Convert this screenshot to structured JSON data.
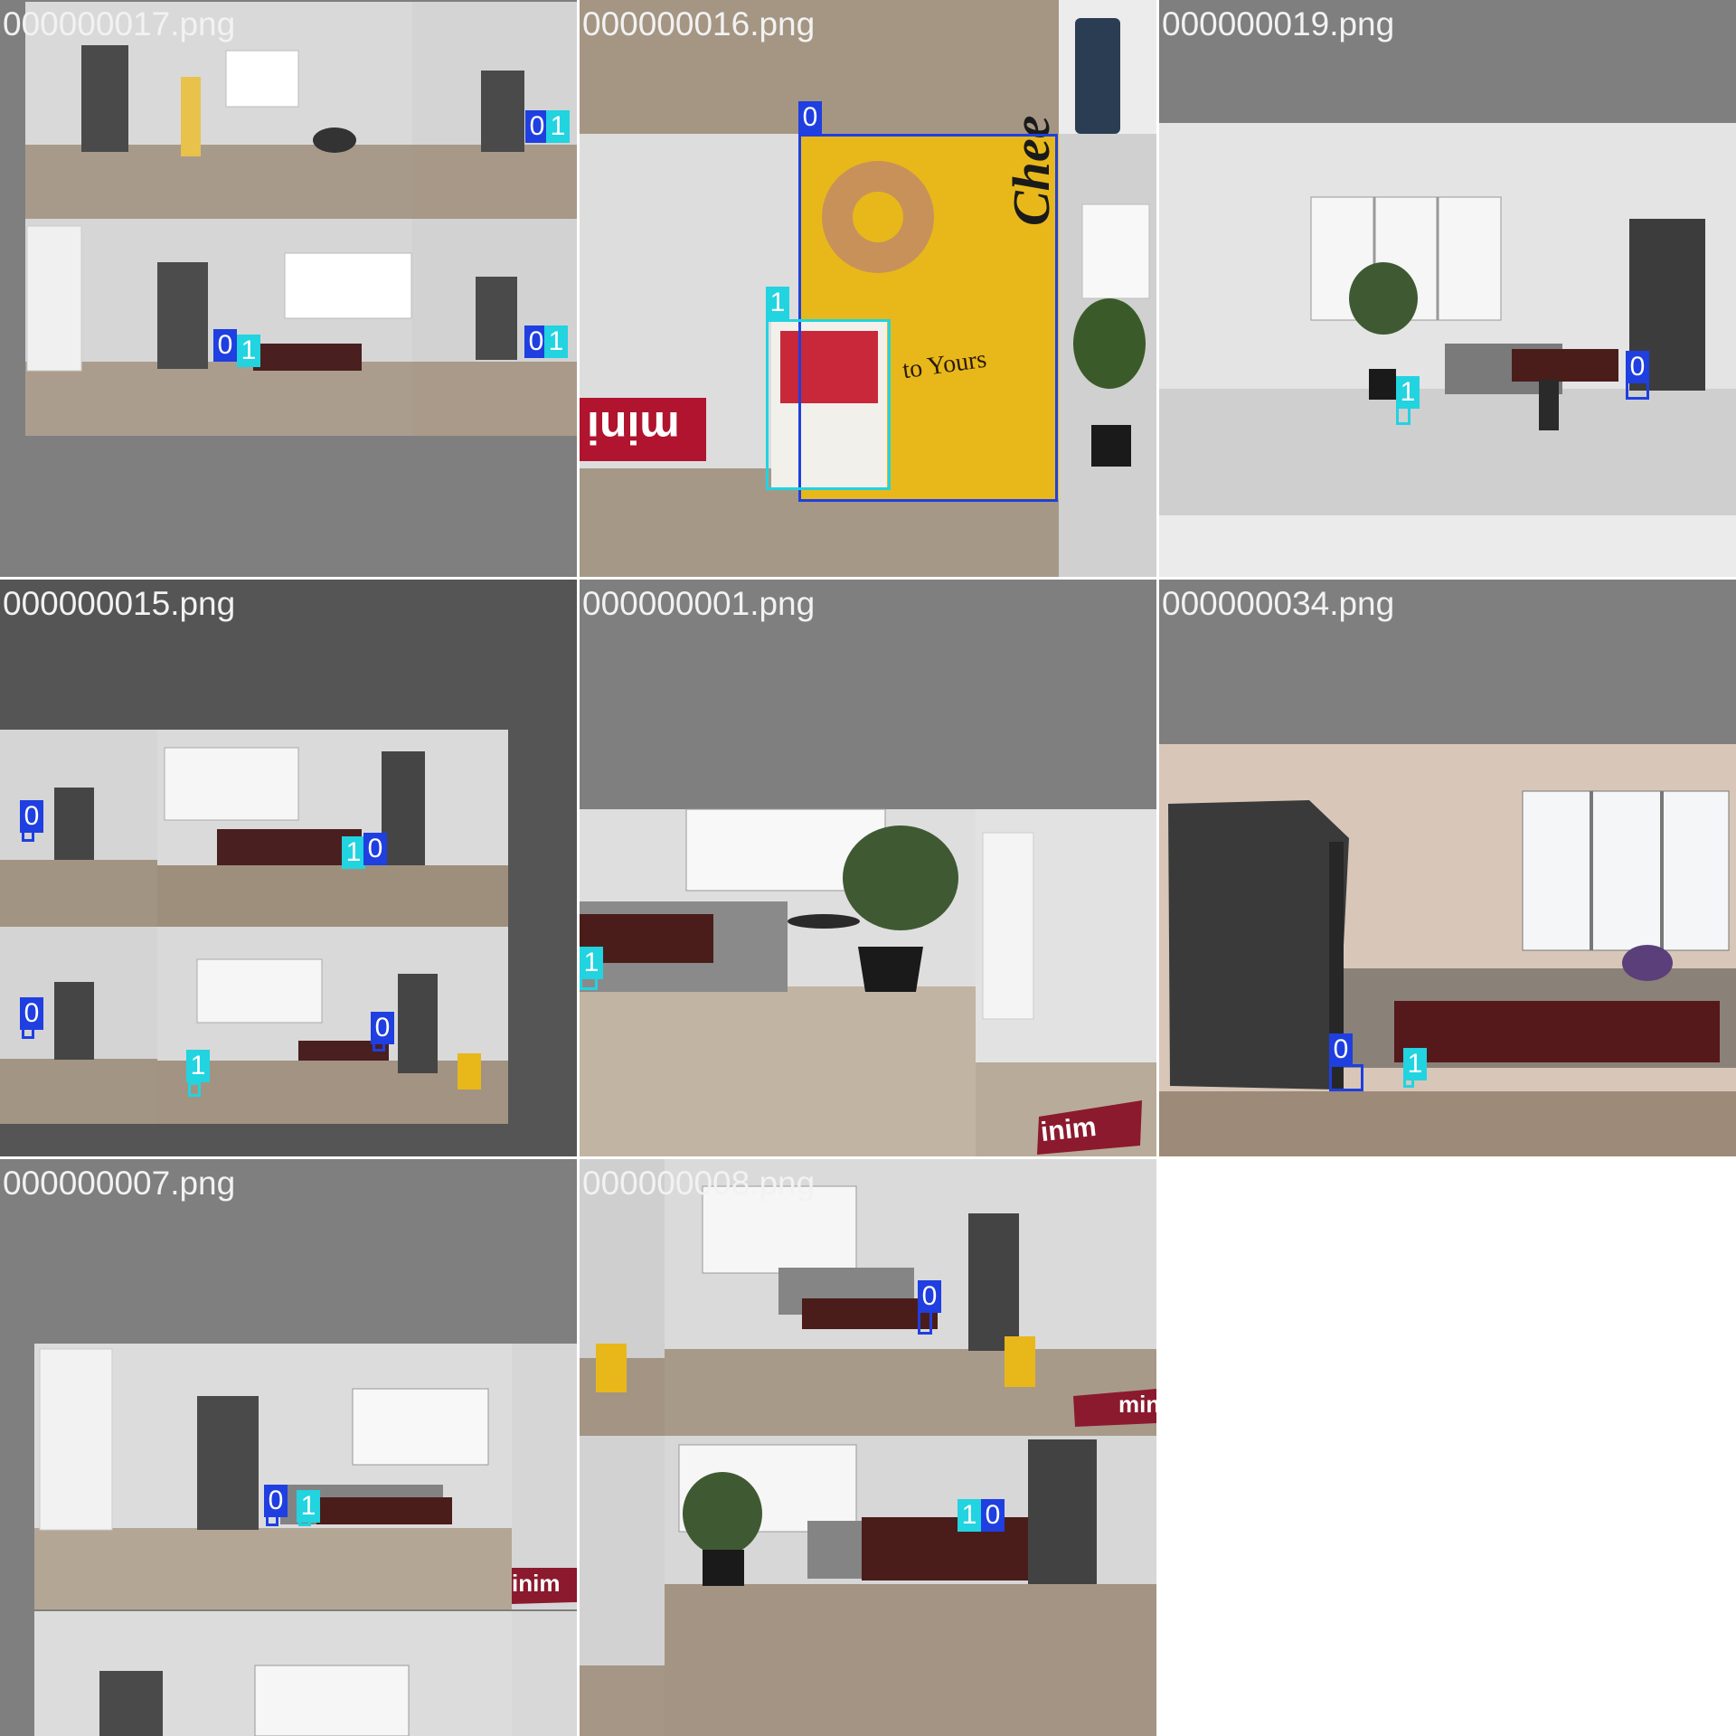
{
  "tiles": [
    {
      "filename": "000000017.png",
      "labels": {
        "l0": "0",
        "l1": "1",
        "l2": "0",
        "l3": "1",
        "l4": "0",
        "l5": "1"
      }
    },
    {
      "filename": "000000016.png",
      "labels": {
        "l0": "0",
        "l1": "1"
      },
      "product_text": {
        "cheerios": "Chee",
        "tagline": "to Yours",
        "mini": "mini"
      }
    },
    {
      "filename": "000000019.png",
      "labels": {
        "l0": "0",
        "l1": "1"
      }
    },
    {
      "filename": "000000015.png",
      "labels": {
        "l0": "0",
        "l1": "1",
        "l2": "0",
        "l3": "0",
        "l4": "1",
        "l5": "0"
      }
    },
    {
      "filename": "000000001.png",
      "labels": {
        "l0": "1"
      },
      "product_text": {
        "mini": "inim"
      }
    },
    {
      "filename": "000000034.png",
      "labels": {
        "l0": "0",
        "l1": "1"
      }
    },
    {
      "filename": "000000007.png",
      "labels": {
        "l0": "0",
        "l1": "1"
      },
      "product_text": {
        "mini": "inim"
      }
    },
    {
      "filename": "000000008.png",
      "labels": {
        "l0": "0",
        "l1": "1",
        "l2": "0"
      },
      "product_text": {
        "mini": "mini"
      }
    }
  ],
  "colors": {
    "class_0": "#1f3fe0",
    "class_1": "#22d3e0",
    "padding_gray": "#7f7f7f",
    "dark_gray": "#555555",
    "floor": "#a49686",
    "wall": "#dcdcdc"
  }
}
